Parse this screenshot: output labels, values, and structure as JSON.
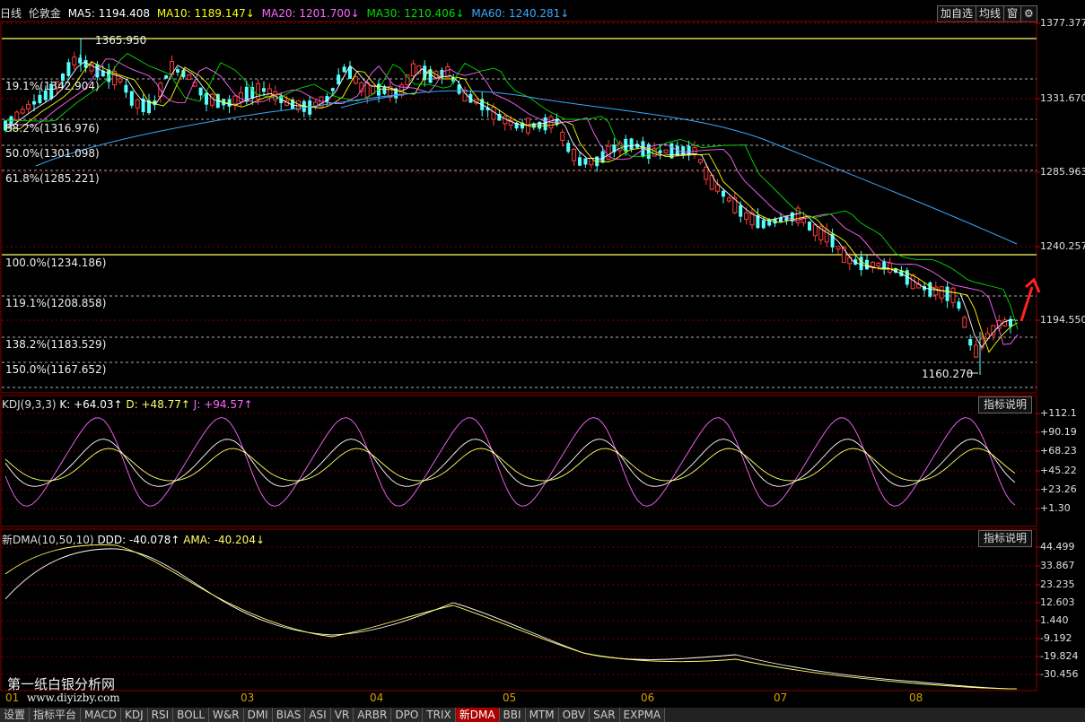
{
  "header": {
    "period": "日线",
    "symbol": "伦敦金",
    "ma5": "MA5: 1194.408",
    "ma10": "MA10: 1189.147↓",
    "ma20": "MA20: 1201.700↓",
    "ma30": "MA30: 1210.406↓",
    "ma60": "MA60: 1240.281↓",
    "btn_add": "加自选",
    "btn_ma": "均线",
    "btn_window": "窗"
  },
  "price_axis": [
    "1377.377",
    "1331.670",
    "1285.963",
    "1240.257",
    "1194.550"
  ],
  "fib_levels": [
    "19.1%(1342.904)",
    "38.2%(1316.976)",
    "50.0%(1301.098)",
    "61.8%(1285.221)",
    "100.0%(1234.186)",
    "119.1%(1208.858)",
    "138.2%(1183.529)",
    "150.0%(1167.652)"
  ],
  "annotations": {
    "high": "1365.950",
    "low": "1160.270"
  },
  "kdj": {
    "title": "KDJ(9,3,3)",
    "k": "K: +64.03↑",
    "d": "D: +48.77↑",
    "j": "J: +94.57↑",
    "explain": "指标说明",
    "axis": [
      "+112.1",
      "+90.19",
      "+68.23",
      "+45.22",
      "+23.26",
      "+1.30"
    ]
  },
  "dma": {
    "title": "新DMA(10,50,10)",
    "ddd": "DDD: -40.078↑",
    "ama": "AMA: -40.204↓",
    "explain": "指标说明",
    "axis": [
      "44.499",
      "33.867",
      "23.235",
      "12.603",
      "1.440",
      "-9.192",
      "-19.824",
      "-30.456"
    ]
  },
  "x_labels": [
    "01",
    "03",
    "04",
    "05",
    "06",
    "07",
    "08"
  ],
  "watermark": {
    "name": "第一纸白银分析网",
    "url": "www.diyizby.com"
  },
  "tabs": [
    "设置",
    "指标平台",
    "MACD",
    "KDJ",
    "RSI",
    "BOLL",
    "W&R",
    "DMI",
    "BIAS",
    "ASI",
    "VR",
    "ARBR",
    "DPO",
    "TRIX",
    "新DMA",
    "BBI",
    "MTM",
    "OBV",
    "SAR",
    "EXPMA"
  ],
  "active_tab": "新DMA",
  "colors": {
    "up": "#ff3b3b",
    "down": "#54ffff",
    "ma5": "#ffffff",
    "ma10": "#ffff00",
    "ma20": "#ff66ff",
    "ma30": "#00dd00",
    "ma60": "#3aa8ff",
    "grid": "#8b0000"
  }
}
